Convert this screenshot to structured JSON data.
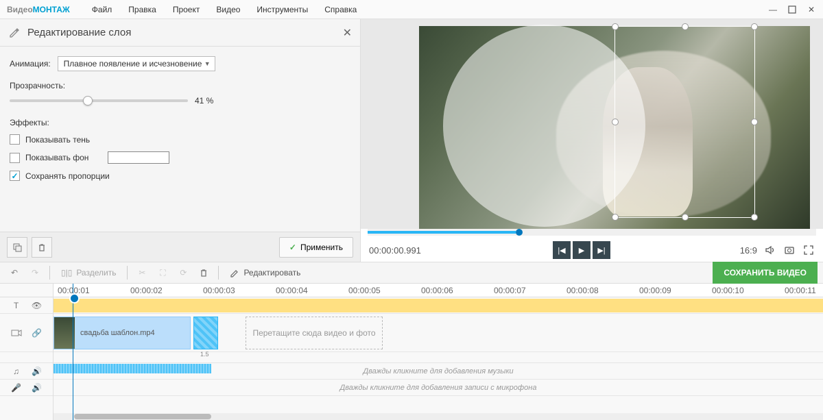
{
  "app": {
    "logo_a": "Видео",
    "logo_b": "МОНТАЖ"
  },
  "menu": {
    "file": "Файл",
    "edit": "Правка",
    "project": "Проект",
    "video": "Видео",
    "tools": "Инструменты",
    "help": "Справка"
  },
  "panel": {
    "title": "Редактирование слоя",
    "animation_label": "Анимация:",
    "animation_value": "Плавное появление и исчезновение",
    "opacity_label": "Прозрачность:",
    "opacity_value": "41 %",
    "opacity_pct": 41,
    "effects_label": "Эффекты:",
    "show_shadow": "Показывать тень",
    "show_bg": "Показывать фон",
    "keep_ratio": "Сохранять пропорции",
    "apply": "Применить"
  },
  "preview": {
    "timecode": "00:00:00.991",
    "ratio": "16:9"
  },
  "toolbar": {
    "split": "Разделить",
    "edit": "Редактировать",
    "save": "СОХРАНИТЬ ВИДЕО"
  },
  "timeline": {
    "ticks": [
      "00:00:01",
      "00:00:02",
      "00:00:03",
      "00:00:04",
      "00:00:05",
      "00:00:06",
      "00:00:07",
      "00:00:08",
      "00:00:09",
      "00:00:10",
      "00:00:11"
    ],
    "clip_name": "свадьба шаблон.mp4",
    "clip_dur": "1.5",
    "dropzone": "Перетащите сюда видео и фото",
    "music_hint": "Дважды кликните для добавления музыки",
    "mic_hint": "Дважды кликните для добавления записи с микрофона"
  }
}
